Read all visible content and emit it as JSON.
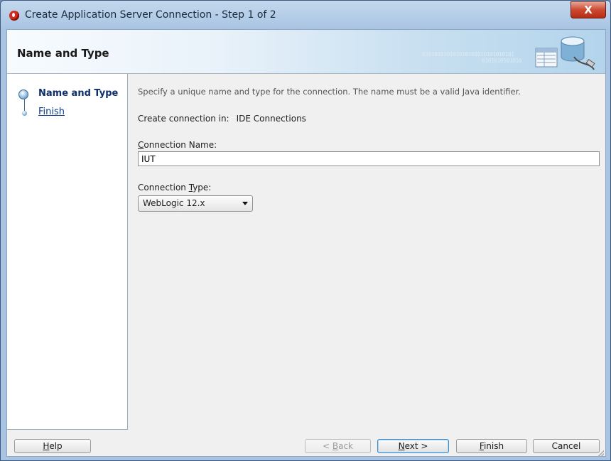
{
  "window": {
    "title": "Create Application Server Connection - Step 1 of 2",
    "close_label": "X"
  },
  "header": {
    "title": "Name and Type",
    "binary_line1": "010101010101010101010101010101",
    "binary_line2": "0101010101010"
  },
  "nav": {
    "items": [
      {
        "label": "Name and Type",
        "state": "current"
      },
      {
        "label": "Finish",
        "state": "pending"
      }
    ]
  },
  "main": {
    "instruction": "Specify a unique name and type for the connection. The name must be a valid Java identifier.",
    "create_in_label": "Create connection in:",
    "create_in_value": "IDE Connections",
    "connection_name_label_mnemonic": "C",
    "connection_name_label_rest": "onnection Name:",
    "connection_name_value": "IUT",
    "connection_type_label_prefix": "Connection ",
    "connection_type_label_mnemonic": "T",
    "connection_type_label_rest": "ype:",
    "connection_type_value": "WebLogic 12.x"
  },
  "footer": {
    "help_mnemonic": "H",
    "help_rest": "elp",
    "back_prefix": "< ",
    "back_mnemonic": "B",
    "back_rest": "ack",
    "next_mnemonic": "N",
    "next_rest": "ext >",
    "finish_mnemonic": "F",
    "finish_rest": "inish",
    "cancel_label": "Cancel"
  },
  "colors": {
    "accent": "#0d2f6a",
    "link": "#0a3a8a",
    "close_red": "#cd4830",
    "default_button_border": "#3e8ec8"
  }
}
